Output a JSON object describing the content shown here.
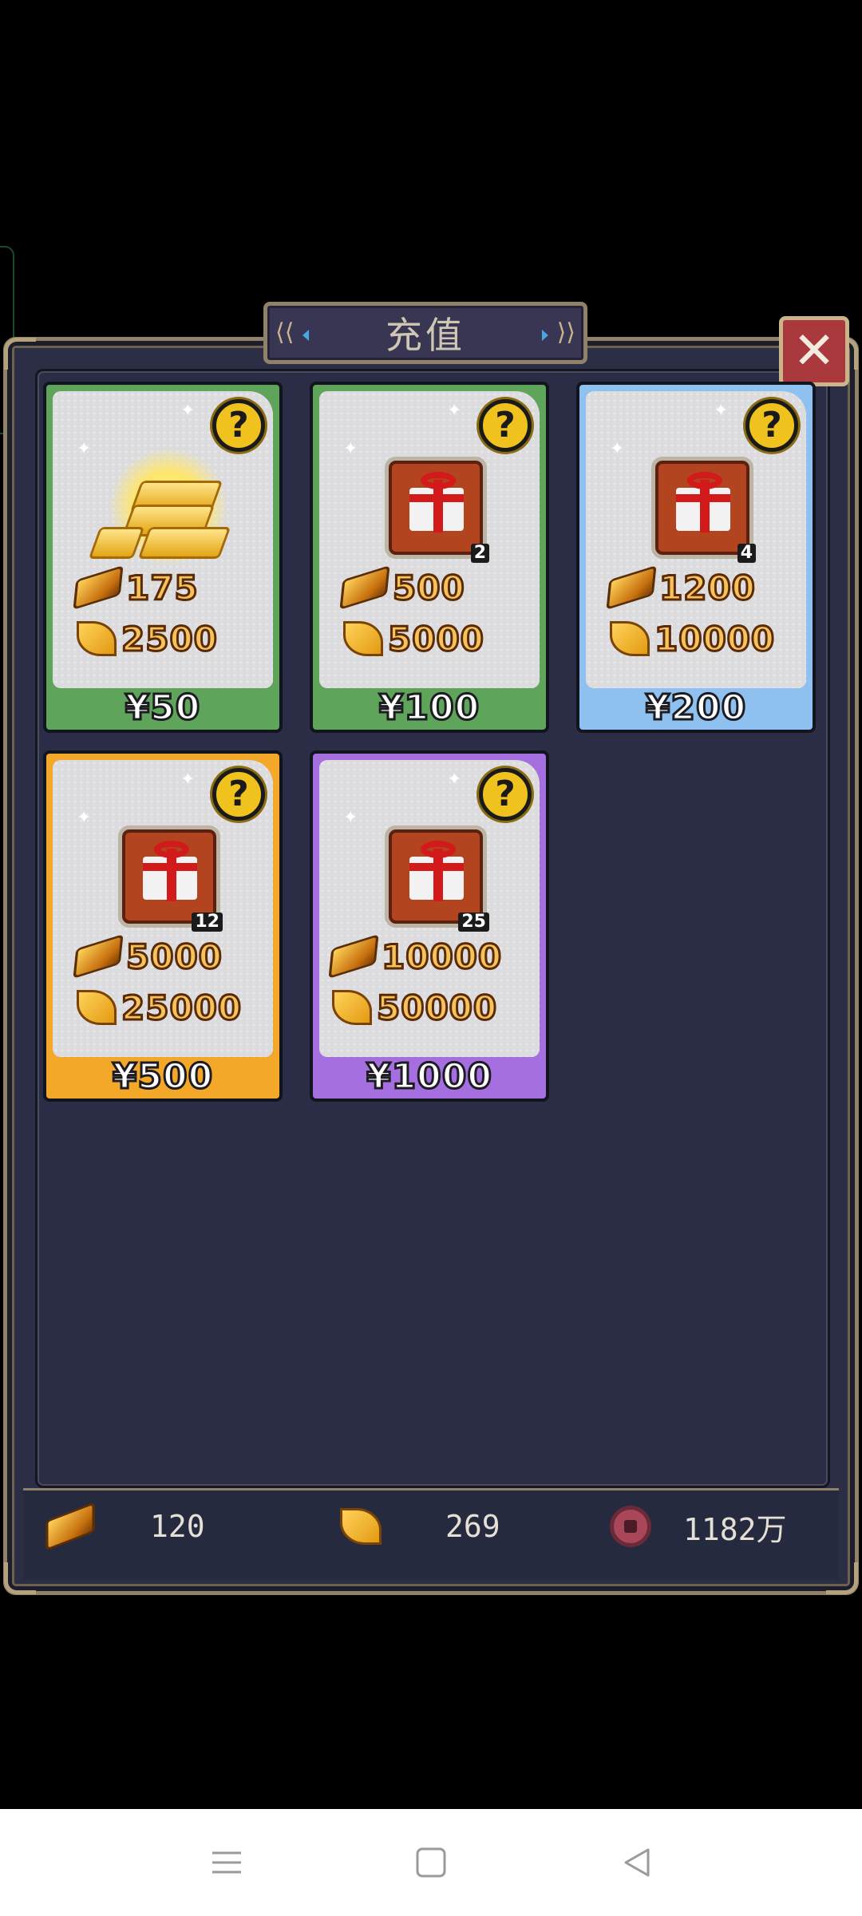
{
  "dialog": {
    "title": "充值"
  },
  "packs": [
    {
      "color": "green",
      "rewards": {
        "ingots": "175",
        "leaves": "2500"
      },
      "gift_count": "",
      "price": "¥50",
      "icon": "gold-pile-icon"
    },
    {
      "color": "green",
      "rewards": {
        "ingots": "500",
        "leaves": "5000"
      },
      "gift_count": "2",
      "price": "¥100",
      "icon": "gift-box-icon"
    },
    {
      "color": "blue",
      "rewards": {
        "ingots": "1200",
        "leaves": "10000"
      },
      "gift_count": "4",
      "price": "¥200",
      "icon": "gift-box-icon"
    },
    {
      "color": "orange",
      "rewards": {
        "ingots": "5000",
        "leaves": "25000"
      },
      "gift_count": "12",
      "price": "¥500",
      "icon": "gift-box-icon"
    },
    {
      "color": "purple",
      "rewards": {
        "ingots": "10000",
        "leaves": "50000"
      },
      "gift_count": "25",
      "price": "¥1000",
      "icon": "gift-box-icon"
    }
  ],
  "currency": {
    "ingots": "120",
    "leaves": "269",
    "coins": "1182万"
  },
  "colors": {
    "green": "#5ea45a",
    "blue": "#8ec0f0",
    "orange": "#f3a82a",
    "purple": "#a66fe0",
    "panel": "#2b2e44",
    "frame": "#8f8269"
  }
}
